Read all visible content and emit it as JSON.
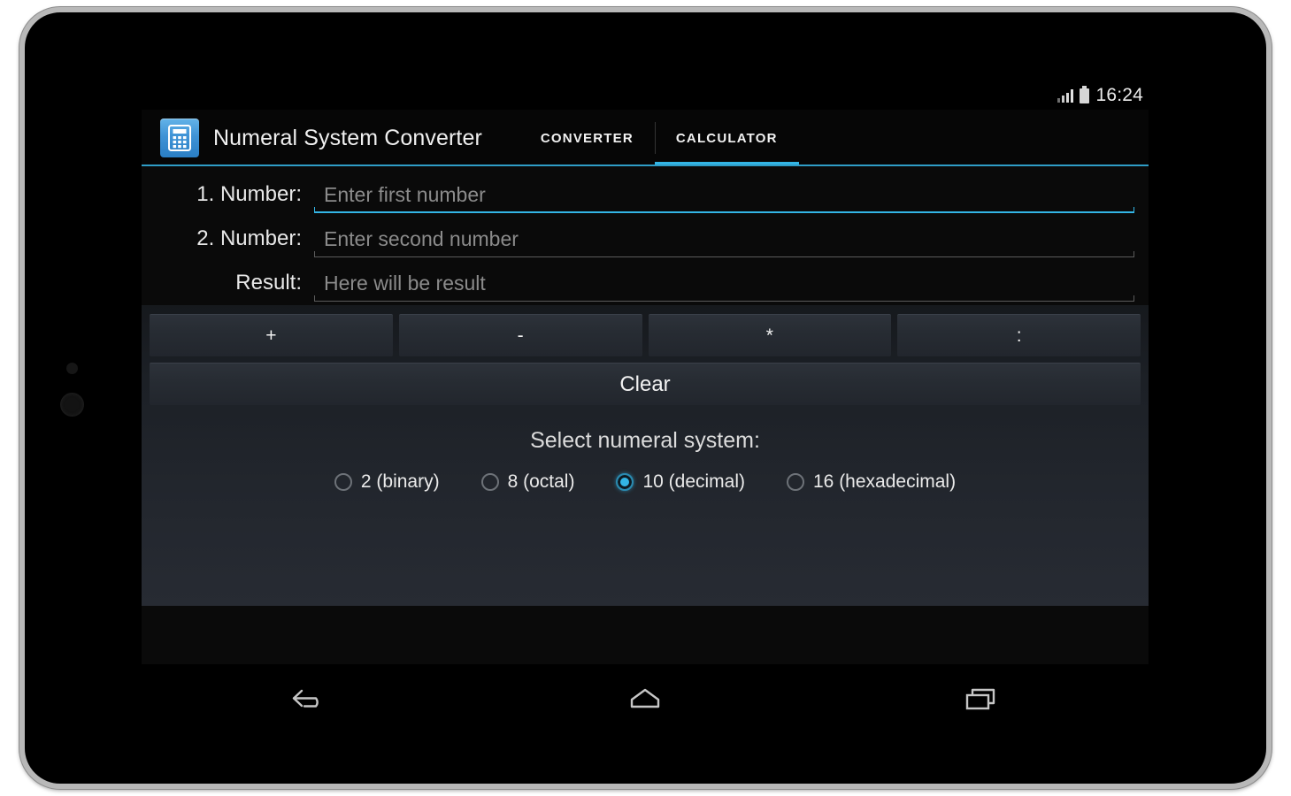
{
  "status_bar": {
    "time": "16:24",
    "signal_icon": "signal-bars-icon",
    "battery_icon": "battery-icon"
  },
  "action_bar": {
    "app_icon": "calculator-app-icon",
    "title": "Numeral System Converter",
    "tabs": [
      {
        "label": "CONVERTER",
        "active": false
      },
      {
        "label": "CALCULATOR",
        "active": true
      }
    ]
  },
  "form": {
    "fields": [
      {
        "label": "1. Number:",
        "value": "",
        "placeholder": "Enter first number",
        "focused": true
      },
      {
        "label": "2. Number:",
        "value": "",
        "placeholder": "Enter second number",
        "focused": false
      },
      {
        "label": "Result:",
        "value": "",
        "placeholder": "Here will be result",
        "focused": false
      }
    ]
  },
  "operations": {
    "buttons": [
      {
        "label": "+",
        "name": "add-button"
      },
      {
        "label": "-",
        "name": "subtract-button"
      },
      {
        "label": "*",
        "name": "multiply-button"
      },
      {
        "label": ":",
        "name": "divide-button"
      }
    ],
    "clear_label": "Clear"
  },
  "numeral_system": {
    "title": "Select numeral system:",
    "selected": "10 (decimal)",
    "options": [
      {
        "label": "2 (binary)",
        "selected": false
      },
      {
        "label": "8 (octal)",
        "selected": false
      },
      {
        "label": "10 (decimal)",
        "selected": true
      },
      {
        "label": "16 (hexadecimal)",
        "selected": false
      }
    ]
  },
  "nav_bar": {
    "back": "back-icon",
    "home": "home-icon",
    "recents": "recents-icon"
  },
  "colors": {
    "accent": "#33b5e5",
    "app_background": "#0a0a0a",
    "panel_bottom": "#272b33",
    "button": "#272c33"
  }
}
